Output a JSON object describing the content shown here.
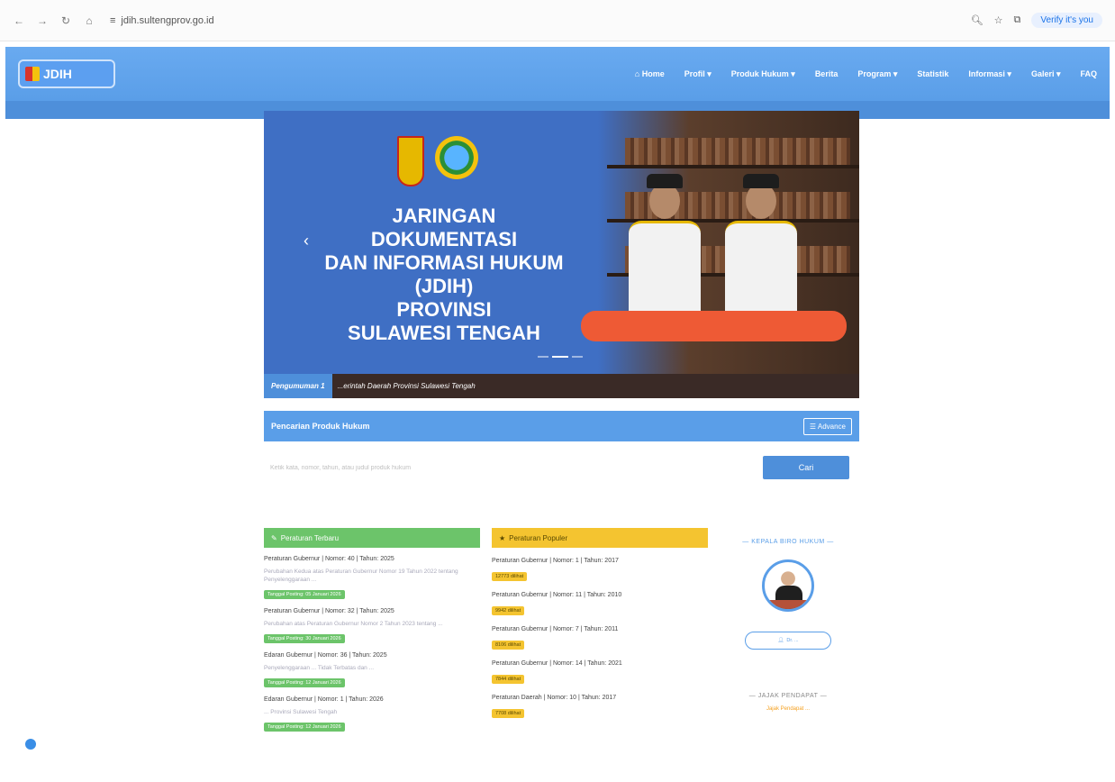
{
  "browser": {
    "url": "jdih.sultengprov.go.id",
    "verify_label": "Verify it's you"
  },
  "navbar": {
    "logo_text": "JDIH",
    "menu": [
      "Home",
      "Profil",
      "Produk Hukum",
      "Berita",
      "Program",
      "Statistik",
      "Informasi",
      "Galeri",
      "FAQ"
    ]
  },
  "banner": {
    "title_lines": [
      "JARINGAN DOKUMENTASI",
      "DAN INFORMASI HUKUM",
      "(JDIH)",
      "PROVINSI",
      "SULAWESI TENGAH"
    ]
  },
  "ticker": {
    "label": "Pengumuman 1",
    "text": "...erintah Daerah Provinsi Sulawesi Tengah"
  },
  "search": {
    "heading": "Pencarian Produk Hukum",
    "advance_label": "Advance",
    "placeholder": "Ketik kata, nomor, tahun, atau judul produk hukum",
    "button": "Cari"
  },
  "col_terbaru": {
    "heading": "Peraturan Terbaru",
    "items": [
      {
        "title": "Peraturan Gubernur | Nomor: 40 | Tahun: 2025",
        "desc": "Perubahan Kedua atas Peraturan Gubernur Nomor 19 Tahun 2022 tentang Penyelenggaraan ...",
        "badge": "Tanggal Posting: 05 Januari 2026"
      },
      {
        "title": "Peraturan Gubernur | Nomor: 32 | Tahun: 2025",
        "desc": "Perubahan atas Peraturan Gubernur Nomor 2 Tahun 2023 tentang ...",
        "badge": "Tanggal Posting: 30 Januari 2026"
      },
      {
        "title": "Edaran Gubernur | Nomor: 36 | Tahun: 2025",
        "desc": "Penyelenggaraan ... Tidak Terbatas dan ...",
        "badge": "Tanggal Posting: 12 Januari 2026"
      },
      {
        "title": "Edaran Gubernur | Nomor: 1 | Tahun: 2026",
        "desc": "... Provinsi Sulawesi Tengah",
        "badge": "Tanggal Posting: 12 Januari 2026"
      }
    ]
  },
  "col_populer": {
    "heading": "Peraturan Populer",
    "items": [
      {
        "title": "Peraturan Gubernur | Nomor: 1 | Tahun: 2017",
        "badge": "12773 dilihat"
      },
      {
        "title": "Peraturan Gubernur | Nomor: 11 | Tahun: 2010",
        "badge": "9942 dilihat"
      },
      {
        "title": "Peraturan Gubernur | Nomor: 7 | Tahun: 2011",
        "badge": "8106 dilihat"
      },
      {
        "title": "Peraturan Gubernur | Nomor: 14 | Tahun: 2021",
        "badge": "7844 dilihat"
      },
      {
        "title": "Peraturan Daerah | Nomor: 10 | Tahun: 2017",
        "badge": "7708 dilihat"
      }
    ]
  },
  "sidebar": {
    "head_title": "KEPALA BIRO HUKUM",
    "name_pill": "Dr. ...",
    "poll_title": "JAJAK PENDAPAT",
    "poll_text": "Jajak Pendapat ..."
  },
  "colors": {
    "primary": "#5a9ee8",
    "green": "#6cc46a",
    "yellow": "#f4c430"
  }
}
